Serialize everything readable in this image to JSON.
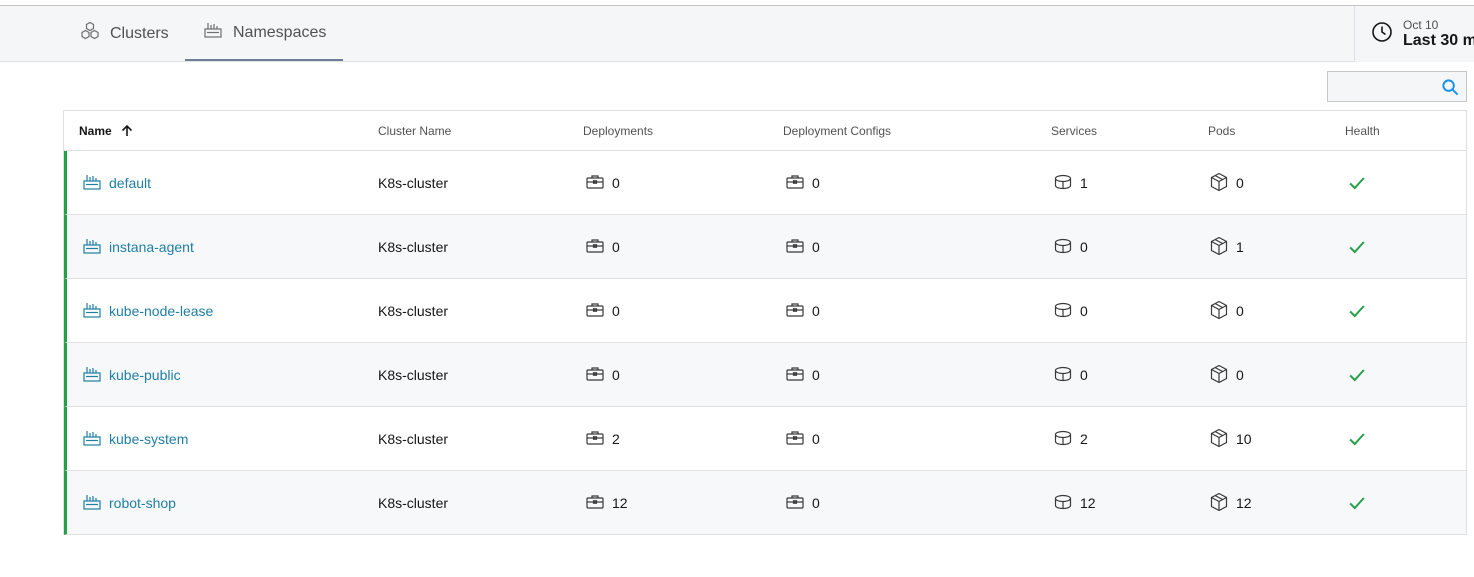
{
  "tabs": [
    {
      "label": "Clusters",
      "icon": "clusters-icon",
      "active": false
    },
    {
      "label": "Namespaces",
      "icon": "namespace-icon",
      "active": true
    }
  ],
  "timepicker": {
    "date": "Oct 10",
    "range": "Last 30 m",
    "icon": "clock-icon"
  },
  "search": {
    "placeholder": "",
    "value": "",
    "icon": "search-icon"
  },
  "table": {
    "columns": {
      "name": "Name",
      "cluster": "Cluster Name",
      "deployments": "Deployments",
      "deployment_configs": "Deployment Configs",
      "services": "Services",
      "pods": "Pods",
      "health": "Health"
    },
    "sort": {
      "column": "name",
      "direction": "ascending",
      "icon": "arrow-up-icon"
    },
    "rows": [
      {
        "name": "default",
        "cluster": "K8s-cluster",
        "deployments": "0",
        "deployment_configs": "0",
        "services": "1",
        "pods": "0",
        "health": "healthy"
      },
      {
        "name": "instana-agent",
        "cluster": "K8s-cluster",
        "deployments": "0",
        "deployment_configs": "0",
        "services": "0",
        "pods": "1",
        "health": "healthy"
      },
      {
        "name": "kube-node-lease",
        "cluster": "K8s-cluster",
        "deployments": "0",
        "deployment_configs": "0",
        "services": "0",
        "pods": "0",
        "health": "healthy"
      },
      {
        "name": "kube-public",
        "cluster": "K8s-cluster",
        "deployments": "0",
        "deployment_configs": "0",
        "services": "0",
        "pods": "0",
        "health": "healthy"
      },
      {
        "name": "kube-system",
        "cluster": "K8s-cluster",
        "deployments": "2",
        "deployment_configs": "0",
        "services": "2",
        "pods": "10",
        "health": "healthy"
      },
      {
        "name": "robot-shop",
        "cluster": "K8s-cluster",
        "deployments": "12",
        "deployment_configs": "0",
        "services": "12",
        "pods": "12",
        "health": "healthy"
      }
    ]
  },
  "colors": {
    "healthy": "#24a148",
    "link": "#1f7fa4",
    "accent": "#1192e8"
  }
}
